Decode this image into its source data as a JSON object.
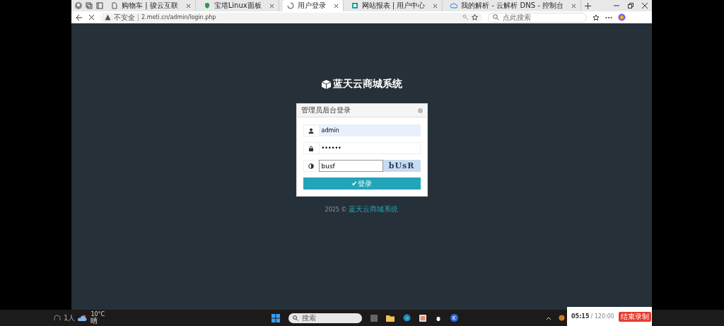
{
  "browser": {
    "tabs": [
      {
        "title": "购物车 | 骏云互联",
        "selected": false,
        "kind": "page"
      },
      {
        "title": "宝塔Linux面板",
        "selected": false,
        "kind": "shield"
      },
      {
        "title": "用户登录",
        "selected": true,
        "kind": "loading"
      },
      {
        "title": "网站报表 | 用户中心",
        "selected": false,
        "kind": "grid"
      },
      {
        "title": "我的解析 - 云解析 DNS - 控制台",
        "selected": false,
        "kind": "cloud"
      }
    ],
    "security": "不安全",
    "url": "2.meti.cn/admin/login.php",
    "search": {
      "placeholder": "点此搜索"
    }
  },
  "page": {
    "brand": "蓝天云商城系统",
    "login": {
      "title": "管理员后台登录",
      "fields": [
        {
          "kind": "user",
          "value": "admin"
        },
        {
          "kind": "lock",
          "value": "••••••"
        },
        {
          "kind": "captcha",
          "value": "busf",
          "captcha_text": "bUsR"
        }
      ],
      "button": "✔登录"
    },
    "footer": {
      "year": "2025 ©",
      "link": "蓝天云商城系统"
    }
  },
  "taskbar": {
    "people": "1人",
    "temperature": "10°C",
    "weather": "晴",
    "search": {
      "placeholder": "搜索"
    }
  },
  "recorder": {
    "elapsed": "05:15",
    "limit": "/ 120:00",
    "stop": "结束录制"
  }
}
